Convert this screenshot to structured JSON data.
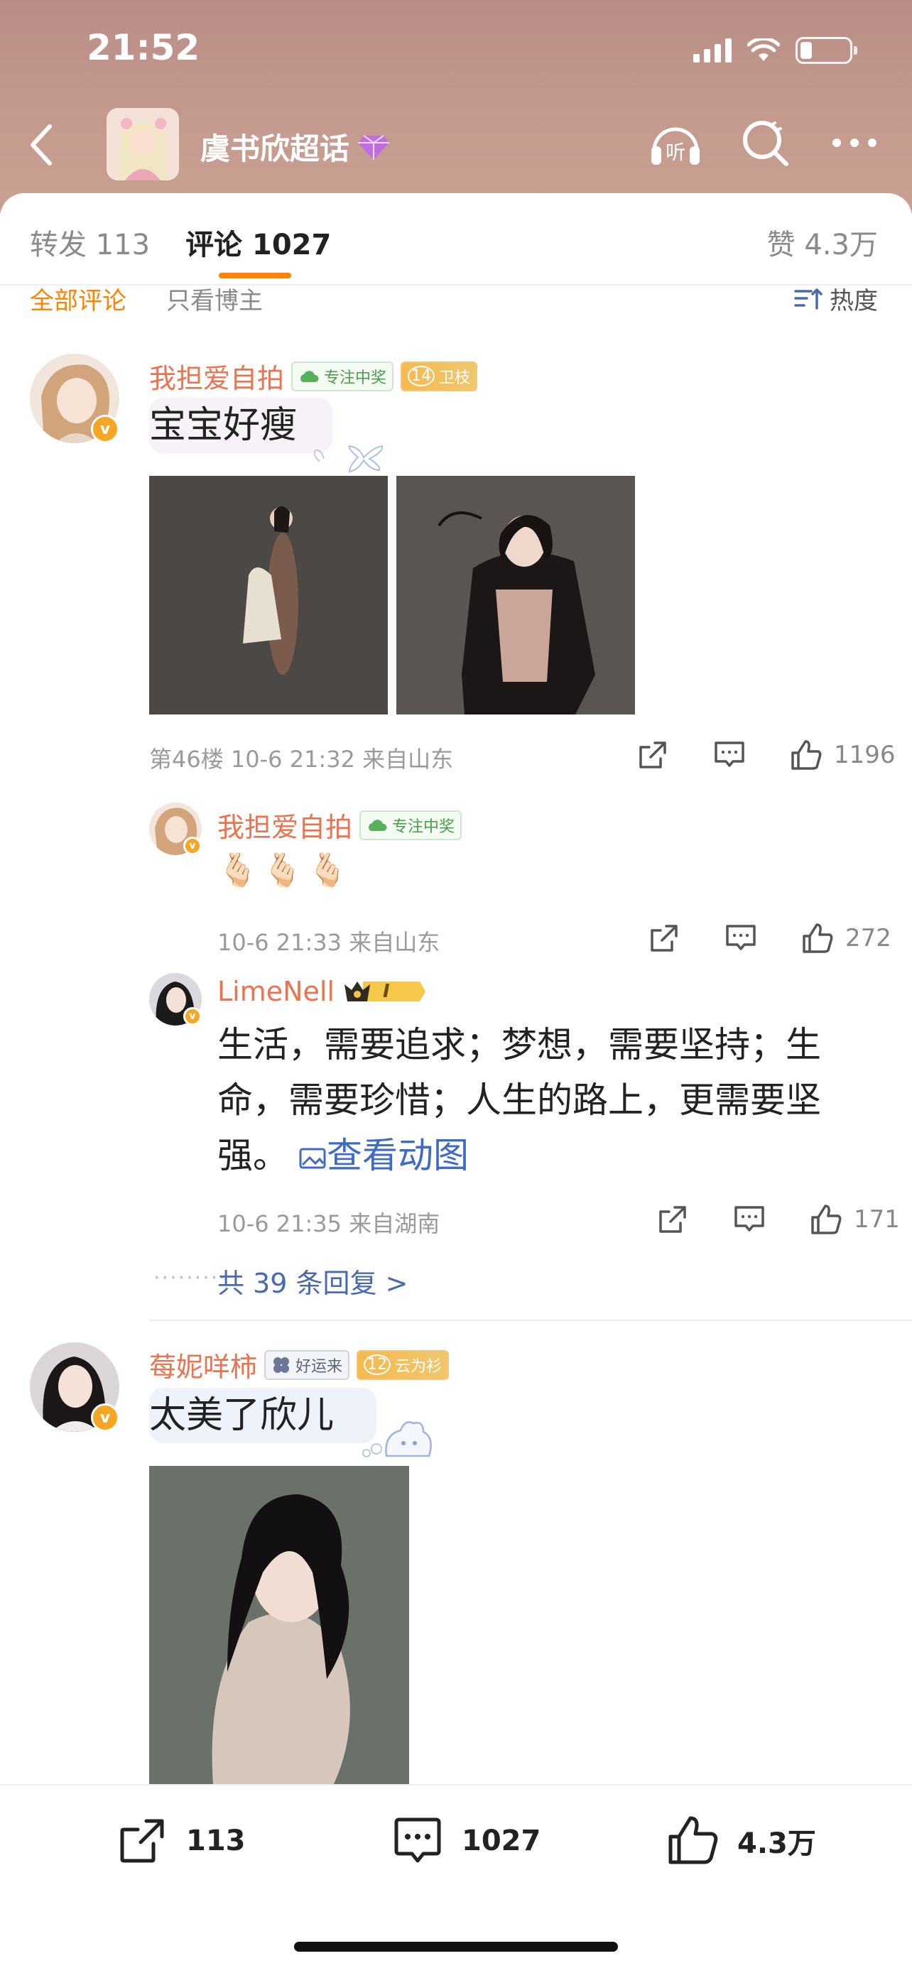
{
  "status": {
    "time": "21:52"
  },
  "nav": {
    "title": "虞书欣超话"
  },
  "tabs": [
    {
      "label": "转发 113"
    },
    {
      "label": "评论 1027"
    }
  ],
  "likes_total": "赞 4.3万",
  "filters": {
    "all": "全部评论",
    "only_op": "只看博主",
    "sort": "热度"
  },
  "comments": [
    {
      "user": "我担爱自拍",
      "tag1": "专注中奖",
      "tag2": "卫枝",
      "tag2_level": "14",
      "text": "宝宝好瘦",
      "meta": "第46楼 10-6 21:32 来自山东",
      "likes": "1196",
      "replies": [
        {
          "user": "我担爱自拍",
          "tag1": "专注中奖",
          "text": "🫰🏻🫰🏻🫰🏻",
          "meta": "10-6 21:33 来自山东",
          "likes": "272"
        },
        {
          "user": "LimeNell",
          "tag_rank": "I",
          "text": "生活，需要追求；梦想，需要坚持；生命，需要珍惜；人生的路上，更需要坚强。",
          "link": "查看动图",
          "meta": "10-6 21:35 来自湖南",
          "likes": "171"
        }
      ],
      "more_replies": "共 39 条回复 >"
    },
    {
      "user": "莓妮咩柿",
      "tag1": "好运来",
      "tag2": "云为衫",
      "tag2_level": "12",
      "text": "太美了欣儿"
    }
  ],
  "bottom_bar": {
    "reposts": "113",
    "comments": "1027",
    "likes": "4.3万"
  },
  "colors": {
    "accent": "#ff8200",
    "username": "#eb7350",
    "link": "#3f6ac6"
  }
}
